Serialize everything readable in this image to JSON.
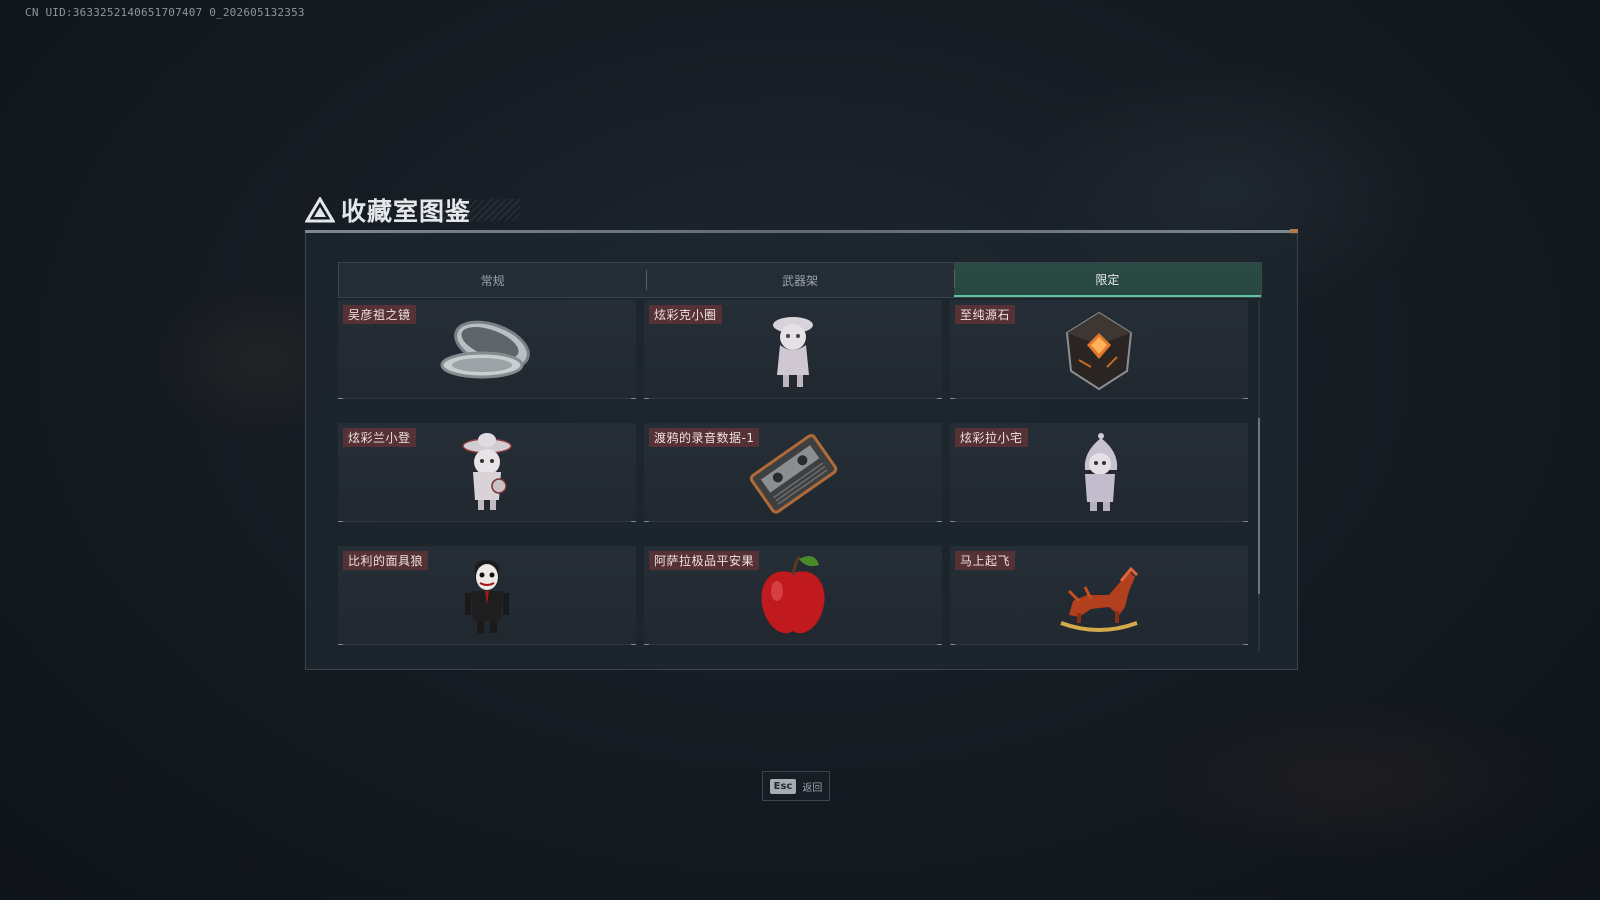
{
  "uid_text": "CN UID:3633252140651707407 0_202605132353",
  "title": "收藏室图鉴",
  "tabs": [
    {
      "label": "常规",
      "active": false
    },
    {
      "label": "武器架",
      "active": false
    },
    {
      "label": "限定",
      "active": true
    }
  ],
  "items": [
    {
      "label": "吴彦祖之镜",
      "icon": "compact-mirror-icon"
    },
    {
      "label": "炫彩克小圈",
      "icon": "figurine-girl-icon"
    },
    {
      "label": "至纯源石",
      "icon": "dark-crystal-icon"
    },
    {
      "label": "炫彩兰小登",
      "icon": "figurine-sombrero-icon"
    },
    {
      "label": "渡鸦的录音数据-1",
      "icon": "cassette-tape-icon"
    },
    {
      "label": "炫彩拉小宅",
      "icon": "figurine-hooded-icon"
    },
    {
      "label": "比利的面具狼",
      "icon": "puppet-doll-icon"
    },
    {
      "label": "阿萨拉极品平安果",
      "icon": "red-apple-icon"
    },
    {
      "label": "马上起飞",
      "icon": "rocking-horse-icon"
    }
  ],
  "footer": {
    "key_label": "Esc",
    "action_label": "返回"
  },
  "colors": {
    "accent": "#5fc49e",
    "label_bg": "#7d3737",
    "panel": "#1e262e"
  }
}
